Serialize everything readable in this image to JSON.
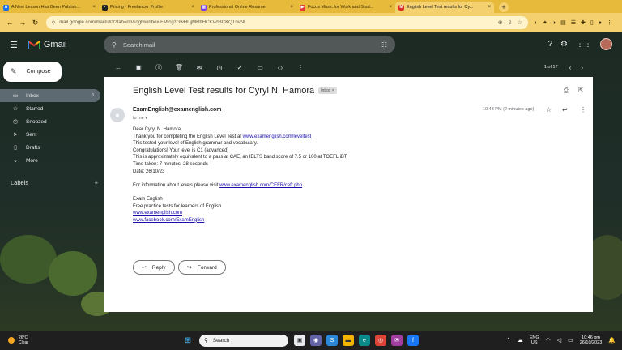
{
  "browser": {
    "tabs": [
      {
        "title": "A New Lesson Has Been Publish...",
        "color": "#1a73e8",
        "glyph": "A",
        "active": false
      },
      {
        "title": "Pricing - Freelancer Profile",
        "color": "#222222",
        "glyph": "✓",
        "active": false
      },
      {
        "title": "Professional Online Resume",
        "color": "#7b3fe4",
        "glyph": "▤",
        "active": false
      },
      {
        "title": "Focus Music for Work and Stud...",
        "color": "#e53935",
        "glyph": "▶",
        "active": false
      },
      {
        "title": "English Level Test results for Cy...",
        "color": "#d93025",
        "glyph": "M",
        "active": true
      }
    ],
    "url": "mail.google.com/mail/u/0/?tab=rm&ogbl#inbox/FMfcgzGwHLjjMRhHCKVdBCKQThvNt"
  },
  "gmail": {
    "logo": "Gmail",
    "search_placeholder": "Search mail",
    "compose_label": "Compose",
    "nav": [
      {
        "label": "Inbox",
        "icon": "inbox-icon",
        "glyph": "▭",
        "count": "6",
        "active": true
      },
      {
        "label": "Starred",
        "icon": "star-icon",
        "glyph": "☆",
        "count": "",
        "active": false
      },
      {
        "label": "Snoozed",
        "icon": "clock-icon",
        "glyph": "◷",
        "count": "",
        "active": false
      },
      {
        "label": "Sent",
        "icon": "send-icon",
        "glyph": "➤",
        "count": "",
        "active": false
      },
      {
        "label": "Drafts",
        "icon": "draft-icon",
        "glyph": "▯",
        "count": "",
        "active": false
      },
      {
        "label": "More",
        "icon": "chevron-down-icon",
        "glyph": "⌄",
        "count": "",
        "active": false
      }
    ],
    "labels_title": "Labels",
    "pagination": "1 of 17"
  },
  "email": {
    "subject": "English Level Test results for Cyryl N. Hamora",
    "badge": "Inbox ×",
    "sender": "ExamEnglish@examenglish.com",
    "to": "to me ▾",
    "time": "10:43 PM (2 minutes ago)",
    "body": {
      "greeting": "Dear Cyryl N. Hamora,",
      "thanks_prefix": "Thank you for completing the English Level Test at ",
      "thanks_link": "www.examenglish.com/leveltest",
      "tested": "This tested your level of English grammar and vocabulary.",
      "congrats": "Congratulations! Your level is C1 (advanced)",
      "equivalent": "This is approximately equivalent to a pass at CAE, an IELTS band score of 7.5 or 100 at TOEFL iBT",
      "time_taken": "Time taken: 7 minutes, 28 seconds",
      "date": "Date: 26/10/23",
      "info_prefix": "For information about levels please visit ",
      "info_link": "www.examenglish.com/CEFR/cefr.php",
      "sig_name": "Exam English",
      "sig_tagline": "Free practice tests for learners of English",
      "sig_link1": "www.examenglish.com",
      "sig_link2": "www.facebook.com/ExamEnglish"
    },
    "reply_label": "Reply",
    "forward_label": "Forward"
  },
  "taskbar": {
    "temp": "26°C",
    "condition": "Clear",
    "search_label": "Search",
    "lang1": "ENG",
    "lang2": "US",
    "time": "10:46 pm",
    "date": "26/10/2023"
  }
}
